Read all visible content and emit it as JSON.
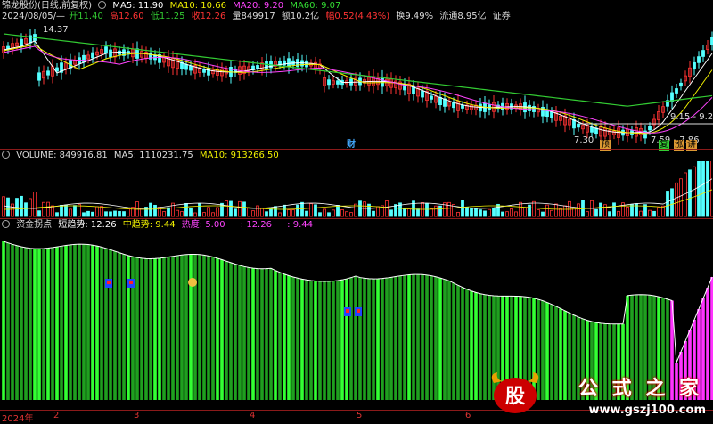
{
  "main": {
    "title": "锦龙股份(日线,前复权)",
    "ma5": "MA5: 11.90",
    "ma10": "MA10: 10.66",
    "ma20": "MA20: 9.20",
    "ma60": "MA60: 9.07",
    "date": "2024/08/05/—",
    "open": "开11.40",
    "high": "高12.60",
    "low": "低11.25",
    "close": "收12.26",
    "volume": "量849917",
    "amount": "额10.2亿",
    "change": "幅0.52(4.43%)",
    "turnover": "换9.49%",
    "float": "流通8.95亿",
    "sector": "证券",
    "label_high": "14.37",
    "label_low": "7.30",
    "label_range1": "9.15 - 9.27",
    "label_range2": "7.59 - 7.86",
    "badge_cai": "财",
    "badge_yu": "预",
    "badge_fu": "复",
    "badge_zhang": "涨",
    "badge_jiang": "讲"
  },
  "volume_panel": {
    "label": "VOLUME: 849916.81",
    "ma5": "MA5: 1110231.75",
    "ma10": "MA10: 913266.50"
  },
  "indicator_panel": {
    "title": "资金拐点",
    "short": "短趋势: 12.26",
    "mid": "中趋势: 9.44",
    "heat": "热度: 5.00",
    "v1": ": 12.26",
    "v2": ": 9.44"
  },
  "xaxis": {
    "labels": [
      "2024年",
      "2",
      "3",
      "4",
      "5",
      "6"
    ]
  },
  "watermark": {
    "title": "公 式 之 家",
    "url": "www.gszj100.com",
    "logo_char": "股"
  }
}
